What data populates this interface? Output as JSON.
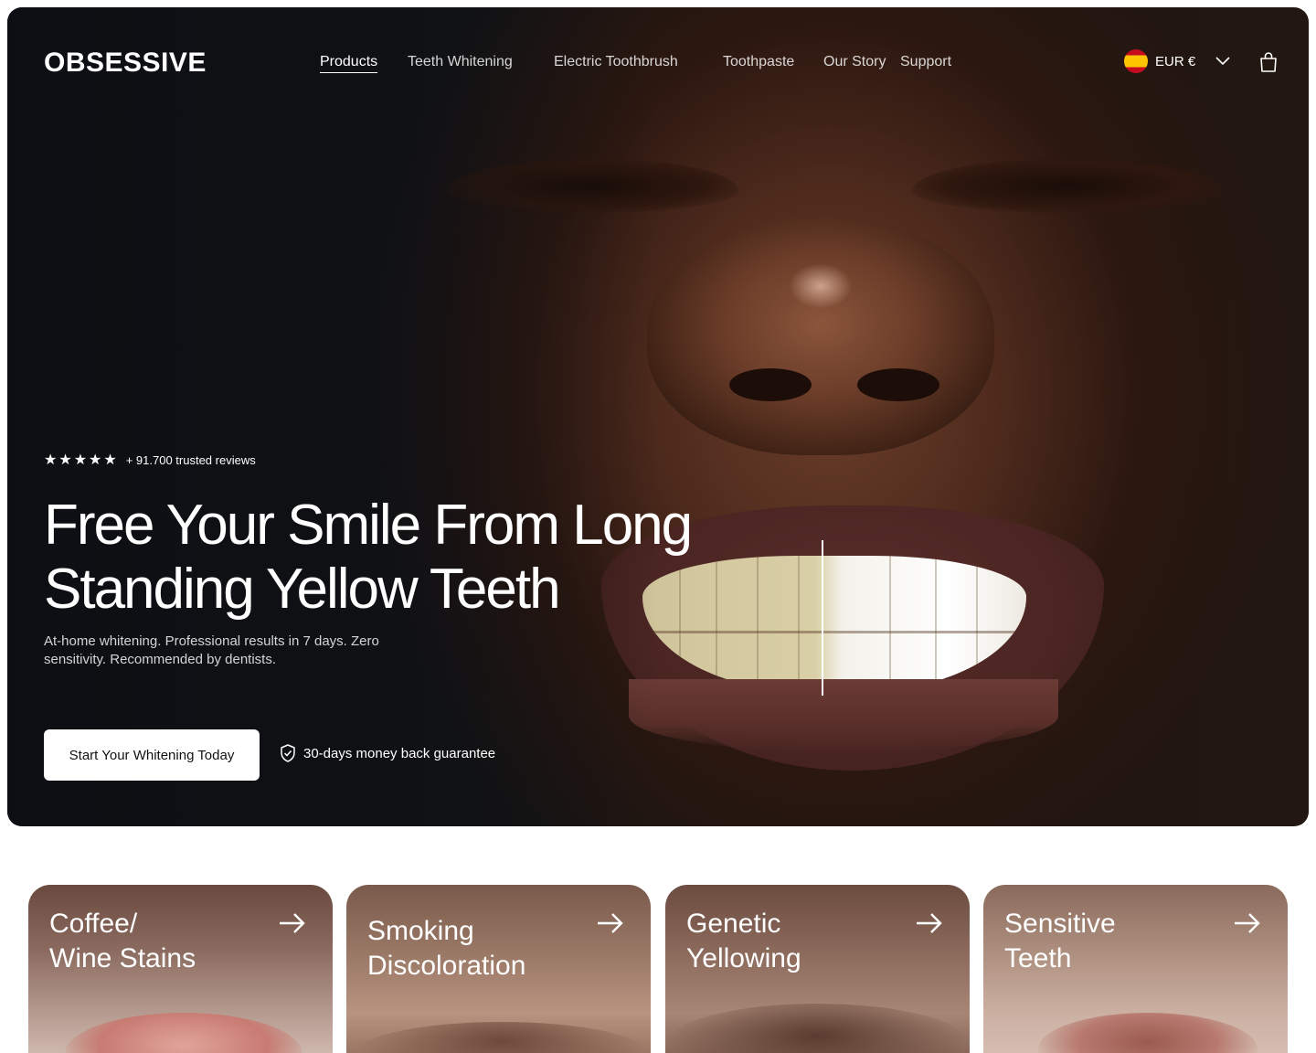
{
  "brand": "OBSESSIVE",
  "nav": {
    "items": [
      {
        "label": "Products",
        "active": true
      },
      {
        "label": "Teeth Whitening",
        "active": false
      },
      {
        "label": "Electric Toothbrush",
        "active": false
      },
      {
        "label": "Toothpaste",
        "active": false
      },
      {
        "label": "Our Story",
        "active": false
      },
      {
        "label": "Support",
        "active": false
      }
    ],
    "currency": "EUR €",
    "currency_flag": "spain-flag-icon",
    "cart_icon": "shopping-bag-icon"
  },
  "hero": {
    "rating_stars": 5,
    "reviews": "+ 91.700 trusted reviews",
    "headline_line1": "Free Your Smile From Long",
    "headline_line2": "Standing Yellow Teeth",
    "subtext": "At-home whitening. Professional results in 7 days. Zero sensitivity. Recommended by dentists.",
    "cta_label": "Start Your Whitening Today",
    "guarantee": "30-days money back guarantee"
  },
  "categories": [
    {
      "line1": "Coffee/",
      "line2": "Wine Stains"
    },
    {
      "line1": "Smoking",
      "line2": "Discoloration"
    },
    {
      "line1": "Genetic",
      "line2": "Yellowing"
    },
    {
      "line1": "Sensitive",
      "line2": "Teeth"
    }
  ],
  "colors": {
    "hero_dark": "#111418",
    "cta_bg": "#ffffff",
    "text_on_dark": "#ffffff"
  }
}
